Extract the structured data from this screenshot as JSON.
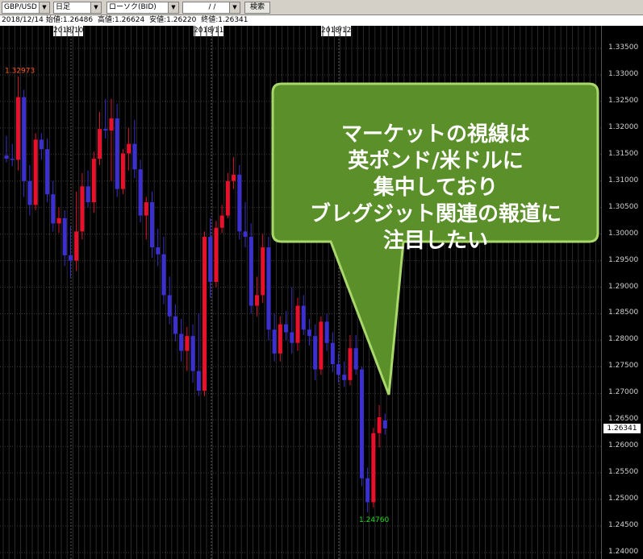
{
  "toolbar": {
    "symbol": "GBP/USD",
    "timeframe": "日足",
    "chart_style": "ローソク(BID)",
    "date_value": "/ /",
    "search_label": "検索"
  },
  "info": {
    "date": "2018/12/14",
    "open_label": "始値:1.26486",
    "high_label": "高値:1.26624",
    "low_label": "安値:1.26220",
    "close_label": "終値:1.26341"
  },
  "x_labels": [
    "2018/10",
    "2018/11",
    "2018/12"
  ],
  "price_ticks": [
    "1.33500",
    "1.33000",
    "1.32500",
    "1.32000",
    "1.31500",
    "1.31000",
    "1.30500",
    "1.30000",
    "1.29500",
    "1.29000",
    "1.28500",
    "1.28000",
    "1.27500",
    "1.27000",
    "1.26500",
    "1.26000",
    "1.25500",
    "1.25000",
    "1.24500",
    "1.24000"
  ],
  "last_price": "1.26341",
  "high_marker": "1.32973",
  "low_marker": "1.24760",
  "callout": {
    "lines": [
      "マーケットの視線は",
      "英ポンド/米ドルに",
      "集中しており",
      "ブレグジット関連の報道に",
      "注目したい"
    ]
  },
  "colors": {
    "up": "#e8102a",
    "down": "#3c2fd0",
    "callout_fill": "#5a8f2a",
    "callout_border": "#a9d86a",
    "high_marker": "#ff5a1a",
    "low_marker": "#22dd22"
  },
  "chart_data": {
    "type": "candlestick",
    "symbol": "GBP/USD",
    "ylim": [
      1.24,
      1.33693
    ],
    "candles": [
      {
        "o": 1.3148,
        "h": 1.3185,
        "l": 1.3135,
        "c": 1.3142
      },
      {
        "o": 1.3142,
        "h": 1.317,
        "l": 1.3128,
        "c": 1.314
      },
      {
        "o": 1.314,
        "h": 1.3297,
        "l": 1.312,
        "c": 1.3258
      },
      {
        "o": 1.3258,
        "h": 1.3272,
        "l": 1.307,
        "c": 1.31
      },
      {
        "o": 1.31,
        "h": 1.313,
        "l": 1.3035,
        "c": 1.3055
      },
      {
        "o": 1.3055,
        "h": 1.319,
        "l": 1.3045,
        "c": 1.3178
      },
      {
        "o": 1.3178,
        "h": 1.319,
        "l": 1.314,
        "c": 1.316
      },
      {
        "o": 1.316,
        "h": 1.318,
        "l": 1.306,
        "c": 1.3075
      },
      {
        "o": 1.3075,
        "h": 1.31,
        "l": 1.3005,
        "c": 1.302
      },
      {
        "o": 1.302,
        "h": 1.305,
        "l": 1.3002,
        "c": 1.303
      },
      {
        "o": 1.303,
        "h": 1.3045,
        "l": 1.294,
        "c": 1.296
      },
      {
        "o": 1.296,
        "h": 1.3015,
        "l": 1.2918,
        "c": 1.295
      },
      {
        "o": 1.295,
        "h": 1.308,
        "l": 1.293,
        "c": 1.3005
      },
      {
        "o": 1.3005,
        "h": 1.3115,
        "l": 1.299,
        "c": 1.309
      },
      {
        "o": 1.309,
        "h": 1.312,
        "l": 1.305,
        "c": 1.306
      },
      {
        "o": 1.306,
        "h": 1.3155,
        "l": 1.304,
        "c": 1.3142
      },
      {
        "o": 1.3142,
        "h": 1.323,
        "l": 1.313,
        "c": 1.3198
      },
      {
        "o": 1.3198,
        "h": 1.3255,
        "l": 1.318,
        "c": 1.3195
      },
      {
        "o": 1.3195,
        "h": 1.3255,
        "l": 1.31,
        "c": 1.3218
      },
      {
        "o": 1.3218,
        "h": 1.3245,
        "l": 1.307,
        "c": 1.3085
      },
      {
        "o": 1.3085,
        "h": 1.316,
        "l": 1.3075,
        "c": 1.3152
      },
      {
        "o": 1.3152,
        "h": 1.32,
        "l": 1.312,
        "c": 1.317
      },
      {
        "o": 1.317,
        "h": 1.3215,
        "l": 1.3105,
        "c": 1.3122
      },
      {
        "o": 1.3122,
        "h": 1.314,
        "l": 1.3022,
        "c": 1.3035
      },
      {
        "o": 1.3035,
        "h": 1.307,
        "l": 1.299,
        "c": 1.306
      },
      {
        "o": 1.306,
        "h": 1.308,
        "l": 1.2955,
        "c": 1.2975
      },
      {
        "o": 1.2975,
        "h": 1.301,
        "l": 1.294,
        "c": 1.2962
      },
      {
        "o": 1.2962,
        "h": 1.2995,
        "l": 1.2868,
        "c": 1.2885
      },
      {
        "o": 1.2885,
        "h": 1.292,
        "l": 1.283,
        "c": 1.2845
      },
      {
        "o": 1.2845,
        "h": 1.2868,
        "l": 1.2798,
        "c": 1.2812
      },
      {
        "o": 1.2812,
        "h": 1.284,
        "l": 1.276,
        "c": 1.278
      },
      {
        "o": 1.278,
        "h": 1.2825,
        "l": 1.2742,
        "c": 1.2808
      },
      {
        "o": 1.2808,
        "h": 1.283,
        "l": 1.272,
        "c": 1.2742
      },
      {
        "o": 1.2742,
        "h": 1.285,
        "l": 1.2695,
        "c": 1.2705
      },
      {
        "o": 1.2705,
        "h": 1.3005,
        "l": 1.2695,
        "c": 1.2995
      },
      {
        "o": 1.2995,
        "h": 1.303,
        "l": 1.288,
        "c": 1.291
      },
      {
        "o": 1.291,
        "h": 1.3025,
        "l": 1.29,
        "c": 1.3012
      },
      {
        "o": 1.3012,
        "h": 1.3055,
        "l": 1.3002,
        "c": 1.3035
      },
      {
        "o": 1.3035,
        "h": 1.3115,
        "l": 1.303,
        "c": 1.31
      },
      {
        "o": 1.31,
        "h": 1.3145,
        "l": 1.3085,
        "c": 1.3112
      },
      {
        "o": 1.3112,
        "h": 1.313,
        "l": 1.299,
        "c": 1.3005
      },
      {
        "o": 1.3005,
        "h": 1.306,
        "l": 1.2975,
        "c": 1.2995
      },
      {
        "o": 1.2995,
        "h": 1.302,
        "l": 1.285,
        "c": 1.2865
      },
      {
        "o": 1.2865,
        "h": 1.292,
        "l": 1.2845,
        "c": 1.2885
      },
      {
        "o": 1.2885,
        "h": 1.3,
        "l": 1.287,
        "c": 1.2975
      },
      {
        "o": 1.2975,
        "h": 1.2995,
        "l": 1.28,
        "c": 1.282
      },
      {
        "o": 1.282,
        "h": 1.285,
        "l": 1.276,
        "c": 1.2775
      },
      {
        "o": 1.2775,
        "h": 1.2845,
        "l": 1.276,
        "c": 1.283
      },
      {
        "o": 1.283,
        "h": 1.2855,
        "l": 1.28,
        "c": 1.2815
      },
      {
        "o": 1.2815,
        "h": 1.29,
        "l": 1.2775,
        "c": 1.2795
      },
      {
        "o": 1.2795,
        "h": 1.288,
        "l": 1.278,
        "c": 1.2865
      },
      {
        "o": 1.2865,
        "h": 1.2885,
        "l": 1.281,
        "c": 1.282
      },
      {
        "o": 1.282,
        "h": 1.284,
        "l": 1.279,
        "c": 1.2808
      },
      {
        "o": 1.2808,
        "h": 1.283,
        "l": 1.2725,
        "c": 1.2745
      },
      {
        "o": 1.2745,
        "h": 1.2845,
        "l": 1.2735,
        "c": 1.2835
      },
      {
        "o": 1.2835,
        "h": 1.285,
        "l": 1.278,
        "c": 1.2795
      },
      {
        "o": 1.2795,
        "h": 1.2815,
        "l": 1.274,
        "c": 1.2755
      },
      {
        "o": 1.2755,
        "h": 1.2775,
        "l": 1.272,
        "c": 1.2735
      },
      {
        "o": 1.2735,
        "h": 1.276,
        "l": 1.2712,
        "c": 1.2725
      },
      {
        "o": 1.2725,
        "h": 1.281,
        "l": 1.2715,
        "c": 1.2785
      },
      {
        "o": 1.2785,
        "h": 1.281,
        "l": 1.2735,
        "c": 1.2745
      },
      {
        "o": 1.2745,
        "h": 1.275,
        "l": 1.2525,
        "c": 1.254
      },
      {
        "o": 1.254,
        "h": 1.256,
        "l": 1.2476,
        "c": 1.2495
      },
      {
        "o": 1.2495,
        "h": 1.2635,
        "l": 1.2485,
        "c": 1.2625
      },
      {
        "o": 1.2625,
        "h": 1.2678,
        "l": 1.2598,
        "c": 1.2655
      },
      {
        "o": 1.2649,
        "h": 1.2662,
        "l": 1.2622,
        "c": 1.2634
      }
    ]
  }
}
